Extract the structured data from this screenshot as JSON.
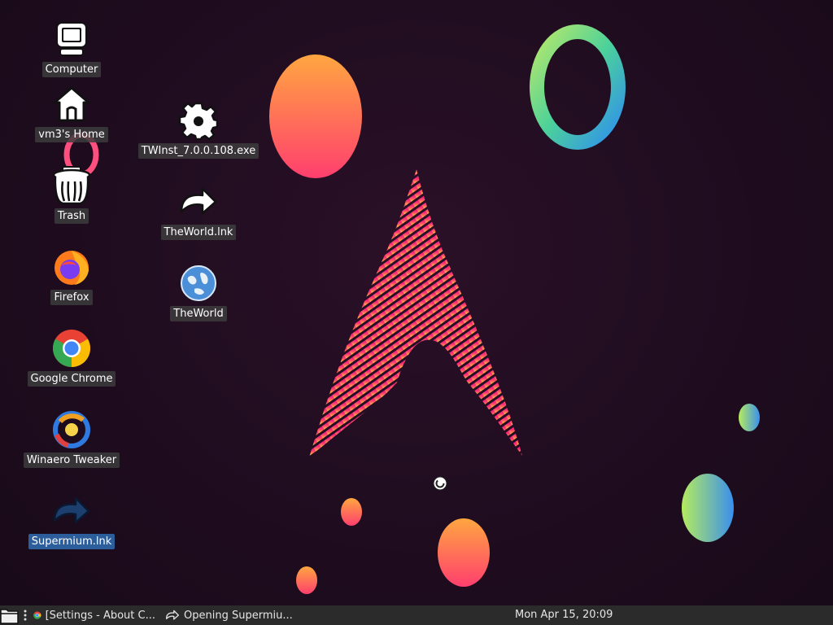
{
  "desktop": {
    "icons": [
      {
        "label": "Computer",
        "icon": "computer-icon"
      },
      {
        "label": "vm3's Home",
        "icon": "home-folder-icon"
      },
      {
        "label": "Trash",
        "icon": "trash-icon"
      },
      {
        "label": "Firefox",
        "icon": "firefox-icon"
      },
      {
        "label": "Google Chrome",
        "icon": "chrome-icon"
      },
      {
        "label": "Winaero Tweaker",
        "icon": "winaero-tweaker-icon"
      },
      {
        "label": "Supermium.lnk",
        "icon": "shortcut-icon",
        "selected": true
      },
      {
        "label": "TWInst_7.0.0.108.exe",
        "icon": "gear-icon"
      },
      {
        "label": "TheWorld.lnk",
        "icon": "shortcut-icon"
      },
      {
        "label": "TheWorld",
        "icon": "globe-icon"
      }
    ]
  },
  "taskbar": {
    "tasks": [
      {
        "label": "[Settings - About C...",
        "icon": "chrome-icon"
      },
      {
        "label": "Opening Supermiu...",
        "icon": "shortcut-icon"
      }
    ],
    "clock": "Mon Apr 15, 20:09"
  },
  "colors": {
    "taskbar_bg": "#2b2b2b",
    "label_bg": "#3c3c3c",
    "selected_label_bg": "#2d5e9c",
    "wallpaper_bg": "#1e0c1e"
  }
}
